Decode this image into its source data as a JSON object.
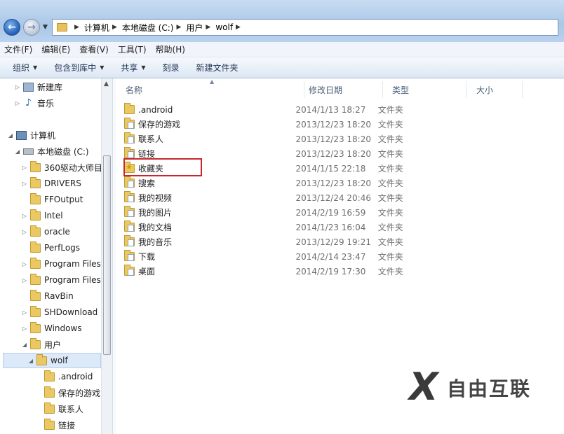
{
  "address": {
    "crumbs": [
      "计算机",
      "本地磁盘 (C:)",
      "用户",
      "wolf"
    ]
  },
  "menu": [
    "文件(F)",
    "编辑(E)",
    "查看(V)",
    "工具(T)",
    "帮助(H)"
  ],
  "commands": [
    {
      "label": "组织",
      "dropdown": true
    },
    {
      "label": "包含到库中",
      "dropdown": true
    },
    {
      "label": "共享",
      "dropdown": true
    },
    {
      "label": "刻录",
      "dropdown": false
    },
    {
      "label": "新建文件夹",
      "dropdown": false
    }
  ],
  "nav": [
    {
      "label": "新建库",
      "icon": "library-icon",
      "level": 1
    },
    {
      "label": "音乐",
      "icon": "music-icon",
      "level": 1
    },
    {
      "label": "计算机",
      "icon": "computer-icon",
      "level": 0
    },
    {
      "label": "本地磁盘 (C:)",
      "icon": "drive-icon",
      "level": 1
    },
    {
      "label": "360驱动大师目",
      "icon": "folder-icon",
      "level": 2
    },
    {
      "label": "DRIVERS",
      "icon": "folder-icon",
      "level": 2
    },
    {
      "label": "FFOutput",
      "icon": "folder-icon",
      "level": 2
    },
    {
      "label": "Intel",
      "icon": "folder-icon",
      "level": 2
    },
    {
      "label": "oracle",
      "icon": "folder-icon",
      "level": 2
    },
    {
      "label": "PerfLogs",
      "icon": "folder-icon",
      "level": 2
    },
    {
      "label": "Program Files",
      "icon": "folder-icon",
      "level": 2
    },
    {
      "label": "Program Files",
      "icon": "folder-icon",
      "level": 2
    },
    {
      "label": "RavBin",
      "icon": "folder-icon",
      "level": 2
    },
    {
      "label": "SHDownload",
      "icon": "folder-icon",
      "level": 2
    },
    {
      "label": "Windows",
      "icon": "folder-icon",
      "level": 2
    },
    {
      "label": "用户",
      "icon": "folder-icon",
      "level": 2
    },
    {
      "label": "wolf",
      "icon": "folder-icon",
      "level": 3
    },
    {
      "label": ".android",
      "icon": "folder-icon",
      "level": 4
    },
    {
      "label": "保存的游戏",
      "icon": "folder-icon",
      "level": 4
    },
    {
      "label": "联系人",
      "icon": "folder-icon",
      "level": 4
    },
    {
      "label": "链接",
      "icon": "folder-icon",
      "level": 4
    }
  ],
  "columns": [
    "名称",
    "修改日期",
    "类型",
    "大小"
  ],
  "files": [
    {
      "name": ".android",
      "date": "2014/1/13 18:27",
      "type": "文件夹"
    },
    {
      "name": "保存的游戏",
      "date": "2013/12/23 18:20",
      "type": "文件夹"
    },
    {
      "name": "联系人",
      "date": "2013/12/23 18:20",
      "type": "文件夹"
    },
    {
      "name": "链接",
      "date": "2013/12/23 18:20",
      "type": "文件夹"
    },
    {
      "name": "收藏夹",
      "date": "2014/1/15 22:18",
      "type": "文件夹"
    },
    {
      "name": "搜索",
      "date": "2013/12/23 18:20",
      "type": "文件夹"
    },
    {
      "name": "我的视频",
      "date": "2013/12/24 20:46",
      "type": "文件夹"
    },
    {
      "name": "我的图片",
      "date": "2014/2/19 16:59",
      "type": "文件夹"
    },
    {
      "name": "我的文档",
      "date": "2014/1/23 16:04",
      "type": "文件夹"
    },
    {
      "name": "我的音乐",
      "date": "2013/12/29 19:21",
      "type": "文件夹"
    },
    {
      "name": "下载",
      "date": "2014/2/14 23:47",
      "type": "文件夹"
    },
    {
      "name": "桌面",
      "date": "2014/2/19 17:30",
      "type": "文件夹"
    }
  ],
  "highlighted_file": "收藏夹",
  "watermark": {
    "mark": "X",
    "brand": "自由互联"
  },
  "colors": {
    "highlight_border": "#c8272e",
    "folder": "#eac862",
    "selection": "#dce9f8"
  }
}
